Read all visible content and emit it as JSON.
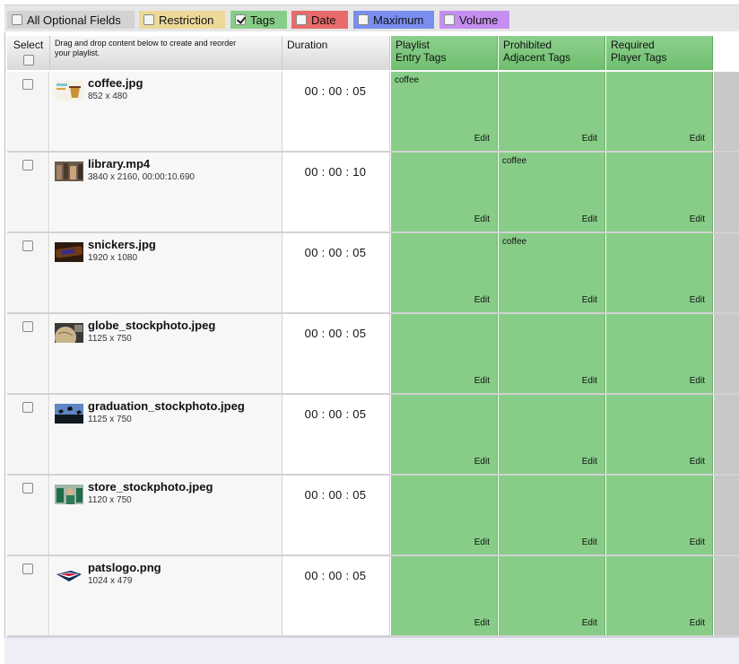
{
  "filters": [
    {
      "label": "All Optional Fields",
      "checked": false,
      "color": "#d3d3d3"
    },
    {
      "label": "Restriction",
      "checked": false,
      "color": "#ecd99a"
    },
    {
      "label": "Tags",
      "checked": true,
      "color": "#87cd87"
    },
    {
      "label": "Date",
      "checked": false,
      "color": "#e86a6a"
    },
    {
      "label": "Maximum",
      "checked": false,
      "color": "#7a8ef0"
    },
    {
      "label": "Volume",
      "checked": false,
      "color": "#c58ef0"
    }
  ],
  "header": {
    "select": "Select",
    "content_line1": "Drag and drop content below to create and reorder",
    "content_line2": "your playlist.",
    "duration": "Duration",
    "tag1_line1": "Playlist",
    "tag1_line2": "Entry Tags",
    "tag2_line1": "Prohibited",
    "tag2_line2": "Adjacent Tags",
    "tag3_line1": "Required",
    "tag3_line2": "Player Tags"
  },
  "rows": [
    {
      "name": "coffee.jpg",
      "meta": "852 x 480",
      "duration": "00 : 00 : 05",
      "entry_tags": "coffee",
      "adjacent_tags": "",
      "player_tags": "",
      "edit": "Edit",
      "thumb": "coffee-thumbnail"
    },
    {
      "name": "library.mp4",
      "meta": "3840 x 2160, 00:00:10.690",
      "duration": "00 : 00 : 10",
      "entry_tags": "",
      "adjacent_tags": "coffee",
      "player_tags": "",
      "edit": "Edit",
      "thumb": "library-thumbnail"
    },
    {
      "name": "snickers.jpg",
      "meta": "1920 x 1080",
      "duration": "00 : 00 : 05",
      "entry_tags": "",
      "adjacent_tags": "coffee",
      "player_tags": "",
      "edit": "Edit",
      "thumb": "snickers-thumbnail"
    },
    {
      "name": "globe_stockphoto.jpeg",
      "meta": "1125 x 750",
      "duration": "00 : 00 : 05",
      "entry_tags": "",
      "adjacent_tags": "",
      "player_tags": "",
      "edit": "Edit",
      "thumb": "globe-thumbnail"
    },
    {
      "name": "graduation_stockphoto.jpeg",
      "meta": "1125 x 750",
      "duration": "00 : 00 : 05",
      "entry_tags": "",
      "adjacent_tags": "",
      "player_tags": "",
      "edit": "Edit",
      "thumb": "graduation-thumbnail"
    },
    {
      "name": "store_stockphoto.jpeg",
      "meta": "1120 x 750",
      "duration": "00 : 00 : 05",
      "entry_tags": "",
      "adjacent_tags": "",
      "player_tags": "",
      "edit": "Edit",
      "thumb": "store-thumbnail"
    },
    {
      "name": "patslogo.png",
      "meta": "1024 x 479",
      "duration": "00 : 00 : 05",
      "entry_tags": "",
      "adjacent_tags": "",
      "player_tags": "",
      "edit": "Edit",
      "thumb": "patriots-logo-thumbnail"
    }
  ]
}
